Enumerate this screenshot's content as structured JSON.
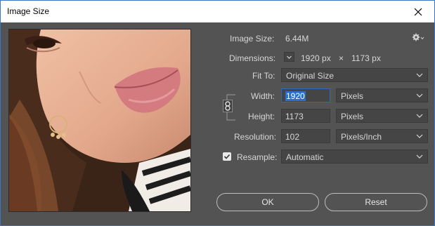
{
  "window": {
    "title": "Image Size"
  },
  "info": {
    "image_size_label": "Image Size:",
    "image_size_value": "6.44M",
    "dimensions_label": "Dimensions:",
    "dim_width": "1920 px",
    "dim_times": "×",
    "dim_height": "1173 px"
  },
  "fit_to": {
    "label": "Fit To:",
    "value": "Original Size"
  },
  "width": {
    "label": "Width:",
    "value": "1920",
    "unit": "Pixels"
  },
  "height": {
    "label": "Height:",
    "value": "1173",
    "unit": "Pixels"
  },
  "resolution": {
    "label": "Resolution:",
    "value": "102",
    "unit": "Pixels/Inch"
  },
  "resample": {
    "label": "Resample:",
    "checked": true,
    "value": "Automatic"
  },
  "buttons": {
    "ok": "OK",
    "reset": "Reset"
  },
  "icons": [
    "close-icon",
    "gear-icon",
    "chevron-down-icon",
    "chain-link-icon",
    "checkmark-icon"
  ]
}
